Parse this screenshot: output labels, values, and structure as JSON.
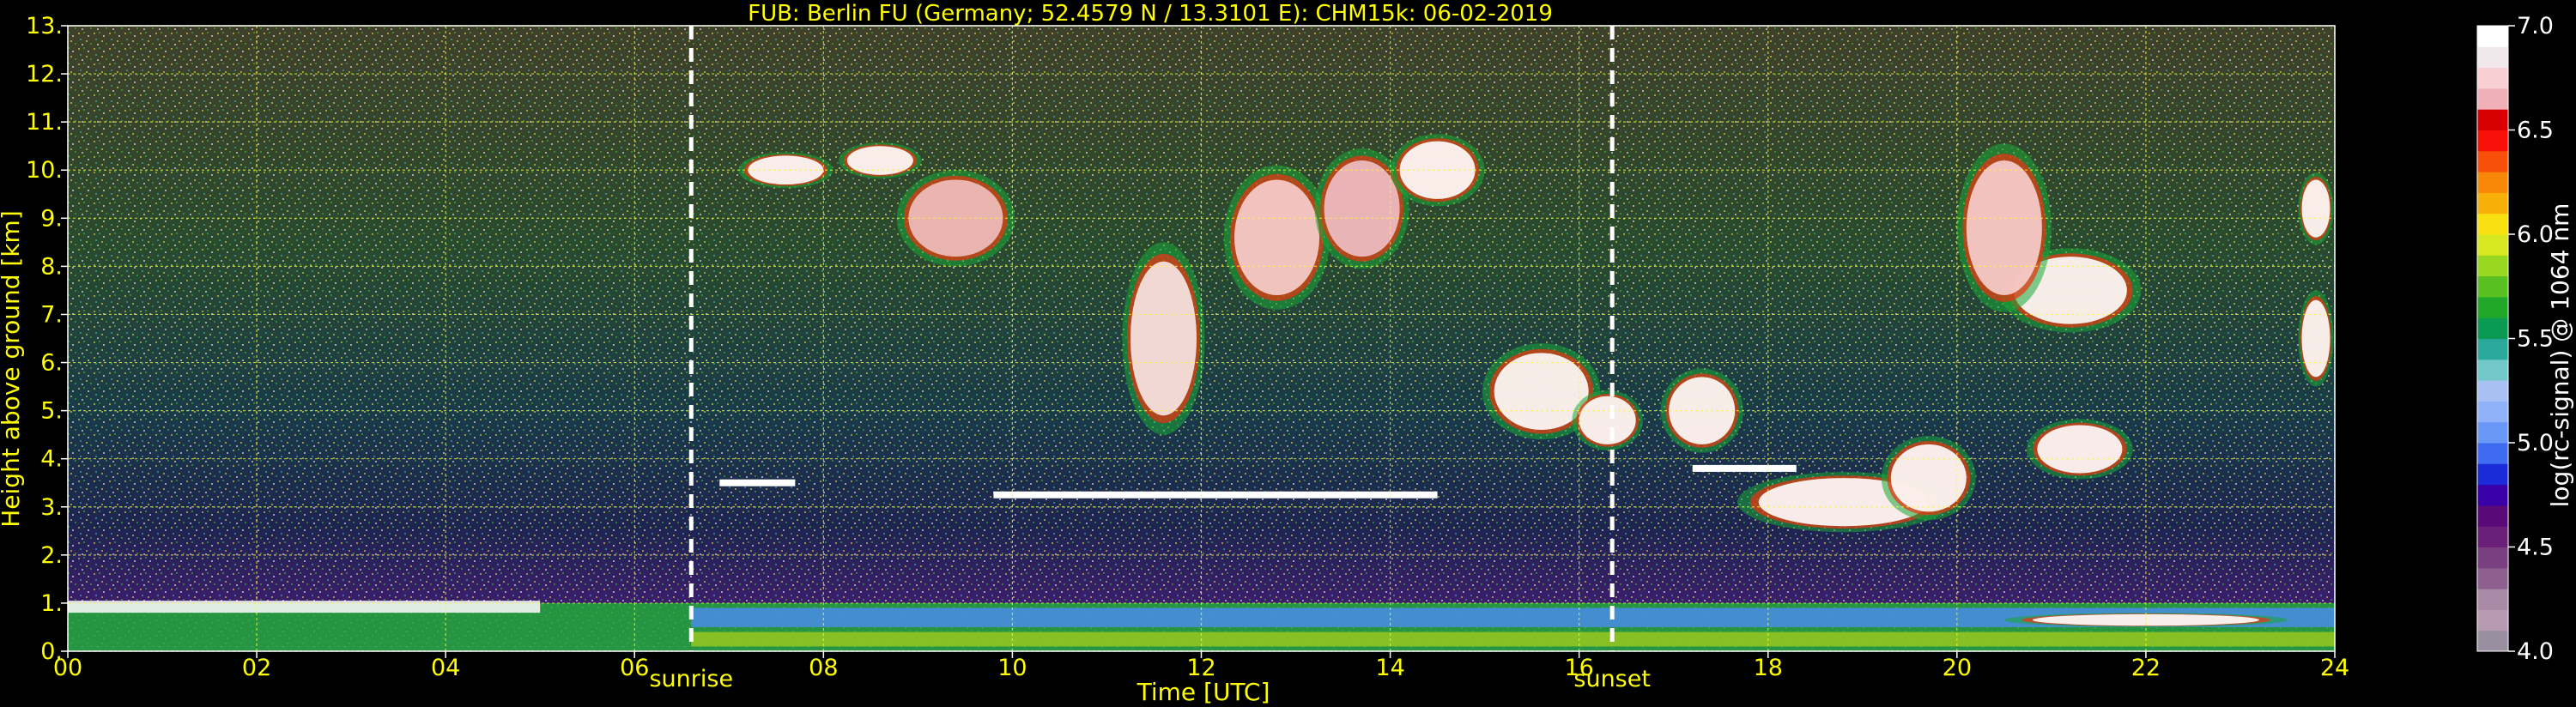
{
  "chart_data": {
    "type": "heatmap",
    "title": "FUB: Berlin FU (Germany; 52.4579 N / 13.3101 E):    CHM15k: 06-02-2019",
    "xlabel": "Time [UTC]",
    "ylabel": "Height above ground [km]",
    "xlim": [
      0,
      24
    ],
    "ylim": [
      0,
      13
    ],
    "x_ticks": [
      "00",
      "02",
      "04",
      "06",
      "08",
      "10",
      "12",
      "14",
      "16",
      "18",
      "20",
      "22",
      "24"
    ],
    "y_ticks": [
      "0.",
      "1.",
      "2.",
      "3.",
      "4.",
      "5.",
      "6.",
      "7.",
      "8.",
      "9.",
      "10.",
      "11.",
      "12.",
      "13."
    ],
    "grid": true,
    "grid_color": "#ffff00",
    "background": "#000000",
    "events": [
      {
        "label": "sunrise",
        "time": 6.6
      },
      {
        "label": "sunset",
        "time": 16.35
      }
    ],
    "colorbar": {
      "label": "log(rc-signal) @ 1064 nm",
      "range": [
        4.0,
        7.0
      ],
      "ticks": [
        "4.0",
        "4.5",
        "5.0",
        "5.5",
        "6.0",
        "6.5",
        "7.0"
      ],
      "colors": [
        "#9a8fa0",
        "#b79ab2",
        "#a889a6",
        "#8c5f8e",
        "#7a3f80",
        "#6a1f78",
        "#5a0a78",
        "#3a00a8",
        "#1a2ad8",
        "#3f6bf0",
        "#6a98f8",
        "#8fb2f8",
        "#a8c0f4",
        "#72c8c8",
        "#2aa89a",
        "#0a9a52",
        "#22a828",
        "#58c020",
        "#98d820",
        "#d8e820",
        "#f8e010",
        "#f8b008",
        "#f88808",
        "#f85008",
        "#f81008",
        "#d80000",
        "#f0b0b8",
        "#f8d0d4",
        "#f0e8ea",
        "#ffffff"
      ]
    },
    "bands": [
      {
        "x0": 0,
        "x1": 24,
        "y0": 0,
        "y1": 1.0,
        "color": "#22a838"
      },
      {
        "x0": 0,
        "x1": 5.0,
        "y0": 0.8,
        "y1": 1.05,
        "color": "#ffffff"
      },
      {
        "x0": 6.6,
        "x1": 24,
        "y0": 0.5,
        "y1": 0.9,
        "color": "#4a8ce8"
      },
      {
        "x0": 6.6,
        "x1": 24,
        "y0": 0.1,
        "y1": 0.4,
        "color": "#98c820"
      }
    ],
    "clouds": [
      {
        "t": 7.6,
        "h": 10.0,
        "rt": 0.4,
        "rh": 0.3,
        "color": "#ffffff"
      },
      {
        "t": 8.6,
        "h": 10.2,
        "rt": 0.35,
        "rh": 0.3,
        "color": "#ffffff"
      },
      {
        "t": 9.4,
        "h": 9.0,
        "rt": 0.5,
        "rh": 0.8,
        "color": "#f0c0c0"
      },
      {
        "t": 11.6,
        "h": 6.5,
        "rt": 0.35,
        "rh": 1.6,
        "color": "#f8e8e8"
      },
      {
        "t": 12.8,
        "h": 8.6,
        "rt": 0.45,
        "rh": 1.2,
        "color": "#f8d0d0"
      },
      {
        "t": 13.7,
        "h": 9.2,
        "rt": 0.4,
        "rh": 1.0,
        "color": "#f0c0c8"
      },
      {
        "t": 14.5,
        "h": 10.0,
        "rt": 0.4,
        "rh": 0.6,
        "color": "#ffffff"
      },
      {
        "t": 15.6,
        "h": 5.4,
        "rt": 0.5,
        "rh": 0.8,
        "color": "#ffffff"
      },
      {
        "t": 16.3,
        "h": 4.8,
        "rt": 0.3,
        "rh": 0.5,
        "color": "#ffffff"
      },
      {
        "t": 17.3,
        "h": 5.0,
        "rt": 0.35,
        "rh": 0.7,
        "color": "#ffffff"
      },
      {
        "t": 18.8,
        "h": 3.1,
        "rt": 0.9,
        "rh": 0.5,
        "color": "#ffffff"
      },
      {
        "t": 19.7,
        "h": 3.6,
        "rt": 0.4,
        "rh": 0.7,
        "color": "#ffffff"
      },
      {
        "t": 21.3,
        "h": 4.2,
        "rt": 0.45,
        "rh": 0.5,
        "color": "#ffffff"
      },
      {
        "t": 21.2,
        "h": 7.5,
        "rt": 0.6,
        "rh": 0.7,
        "color": "#ffffff"
      },
      {
        "t": 20.5,
        "h": 8.8,
        "rt": 0.4,
        "rh": 1.4,
        "color": "#f8d0d0"
      },
      {
        "t": 23.8,
        "h": 6.5,
        "rt": 0.15,
        "rh": 0.8,
        "color": "#ffffff"
      },
      {
        "t": 23.8,
        "h": 9.2,
        "rt": 0.15,
        "rh": 0.6,
        "color": "#ffffff"
      },
      {
        "t": 22.0,
        "h": 0.65,
        "rt": 1.2,
        "rh": 0.12,
        "color": "#ffffff"
      }
    ],
    "layers": [
      {
        "x0": 6.9,
        "x1": 7.7,
        "y": 3.5,
        "color": "#ffffff"
      },
      {
        "x0": 9.8,
        "x1": 14.5,
        "y": 3.25,
        "color": "#ffffff"
      },
      {
        "x0": 17.2,
        "x1": 18.3,
        "y": 3.8,
        "color": "#ffffff"
      }
    ]
  }
}
